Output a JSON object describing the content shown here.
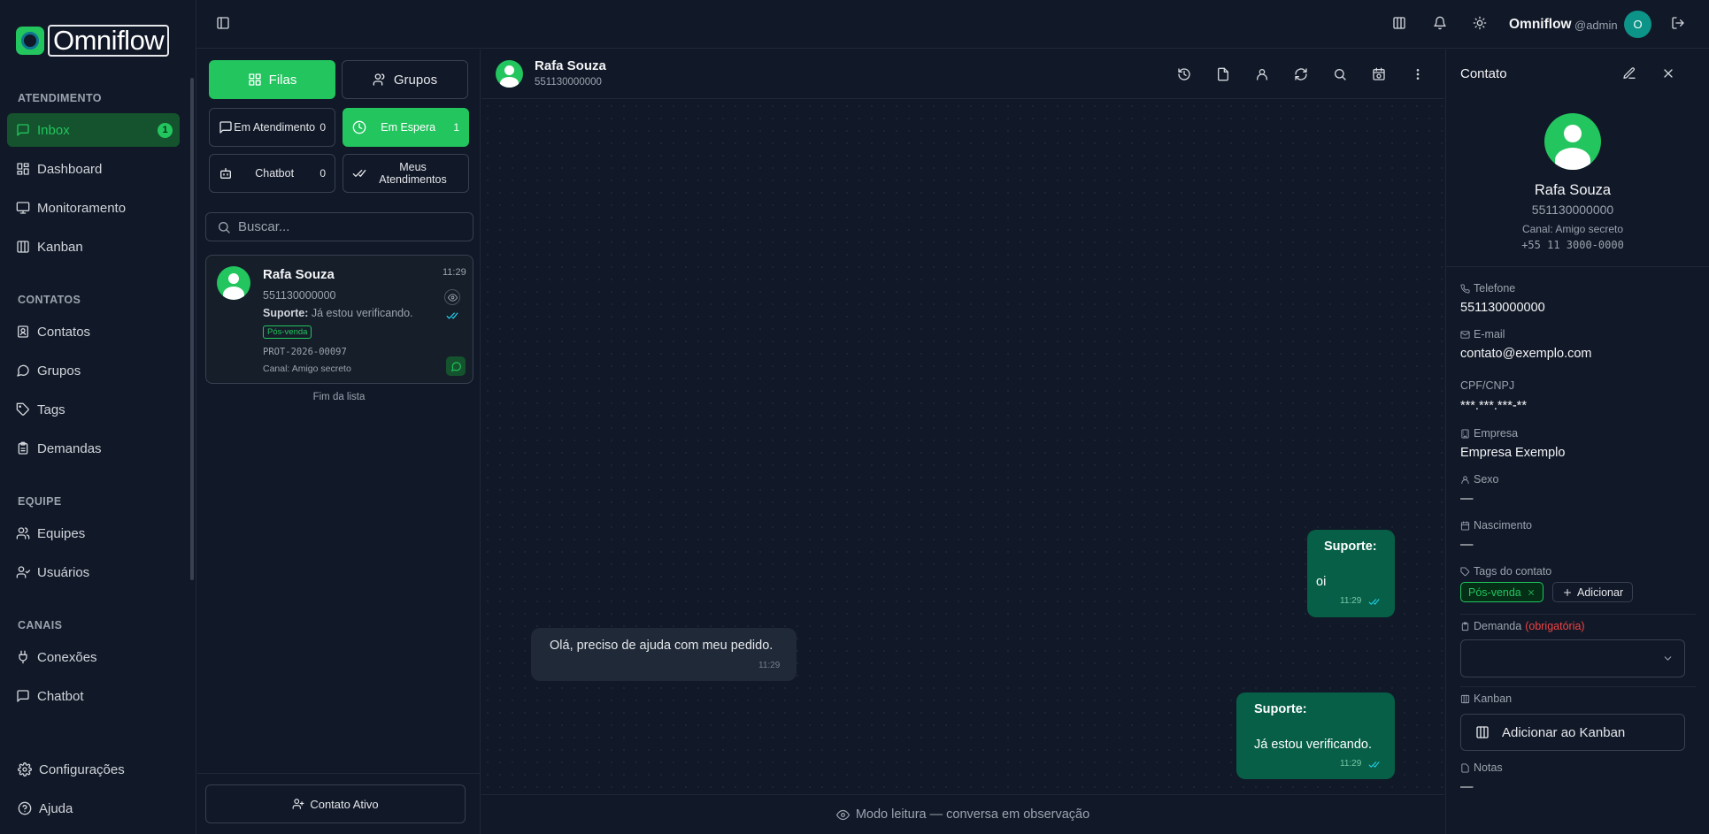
{
  "app": {
    "name": "Omniflow"
  },
  "sidebar": {
    "sections": [
      {
        "title": "ATENDIMENTO"
      },
      {
        "title": "CONTATOS"
      },
      {
        "title": "EQUIPE"
      },
      {
        "title": "CANAIS"
      }
    ],
    "items": [
      {
        "label": "Inbox",
        "icon": "message-square-icon",
        "badge": "1",
        "active": true
      },
      {
        "label": "Dashboard",
        "icon": "layout-grid-icon"
      },
      {
        "label": "Monitoramento",
        "icon": "monitor-icon"
      },
      {
        "label": "Kanban",
        "icon": "kanban-icon"
      },
      {
        "label": "Contatos",
        "icon": "contacts-icon"
      },
      {
        "label": "Grupos",
        "icon": "message-circle-icon"
      },
      {
        "label": "Tags",
        "icon": "tag-icon"
      },
      {
        "label": "Demandas",
        "icon": "clipboard-icon"
      },
      {
        "label": "Equipes",
        "icon": "users-icon"
      },
      {
        "label": "Usuários",
        "icon": "user-group-icon"
      },
      {
        "label": "Conexões",
        "icon": "plug-icon"
      },
      {
        "label": "Chatbot",
        "icon": "bot-message-icon"
      }
    ],
    "bottom": [
      {
        "label": "Configurações",
        "icon": "gear-icon"
      },
      {
        "label": "Ajuda",
        "icon": "help-circle-icon"
      }
    ]
  },
  "topbar": {
    "user_name": "Omniflow",
    "user_handle": "@admin",
    "avatar_initial": "O"
  },
  "list": {
    "tabs": [
      {
        "label": "Filas",
        "active": true
      },
      {
        "label": "Grupos",
        "active": false
      }
    ],
    "filters": [
      {
        "label": "Em Atendimento",
        "count": "0"
      },
      {
        "label": "Em Espera",
        "count": "1",
        "active": true
      },
      {
        "label": "Chatbot",
        "count": "0"
      },
      {
        "label": "Meus Atendimentos",
        "count": ""
      }
    ],
    "search_placeholder": "Buscar...",
    "conversation": {
      "name": "Rafa Souza",
      "phone": "551130000000",
      "time": "11:29",
      "preview_sender": "Suporte:",
      "preview_text": "Já estou verificando.",
      "tag": "Pós-venda",
      "protocol": "PROT-2026-00097",
      "channel_label": "Canal:",
      "channel": "Amigo secreto"
    },
    "end_text": "Fim da lista",
    "active_contact_button": "Contato Ativo"
  },
  "chat": {
    "contact_name": "Rafa Souza",
    "contact_phone": "551130000000",
    "messages": [
      {
        "direction": "out",
        "sender": "Suporte:",
        "text": "oi",
        "time": "11:29"
      },
      {
        "direction": "in",
        "sender": "",
        "text": "Olá, preciso de ajuda com meu pedido.",
        "time": "11:29"
      },
      {
        "direction": "out",
        "sender": "Suporte:",
        "text": "Já estou verificando.",
        "time": "11:29"
      }
    ],
    "footer_text": "Modo leitura — conversa em observação"
  },
  "contact": {
    "panel_title": "Contato",
    "name": "Rafa Souza",
    "phone": "551130000000",
    "channel_line": "Canal: Amigo secreto",
    "formatted_phone": "+55 11 3000-0000",
    "fields": {
      "phone_label": "Telefone",
      "phone_value": "551130000000",
      "email_label": "E-mail",
      "email_value": "contato@exemplo.com",
      "doc_label": "CPF/CNPJ",
      "doc_value": "***.***.***-**",
      "company_label": "Empresa",
      "company_value": "Empresa Exemplo",
      "sex_label": "Sexo",
      "sex_value": "—",
      "birth_label": "Nascimento",
      "birth_value": "—",
      "tags_label": "Tags do contato",
      "tag_value": "Pós-venda",
      "add_tag_label": "Adicionar",
      "demand_label": "Demanda",
      "demand_required": "(obrigatória)",
      "kanban_label": "Kanban",
      "kanban_button": "Adicionar ao Kanban",
      "notes_label": "Notas",
      "notes_value": "—"
    }
  },
  "colors": {
    "accent": "#22c55e",
    "background": "#111827",
    "bubble_out": "#065f46",
    "bubble_in": "#1f2937",
    "required": "#ef4444"
  }
}
